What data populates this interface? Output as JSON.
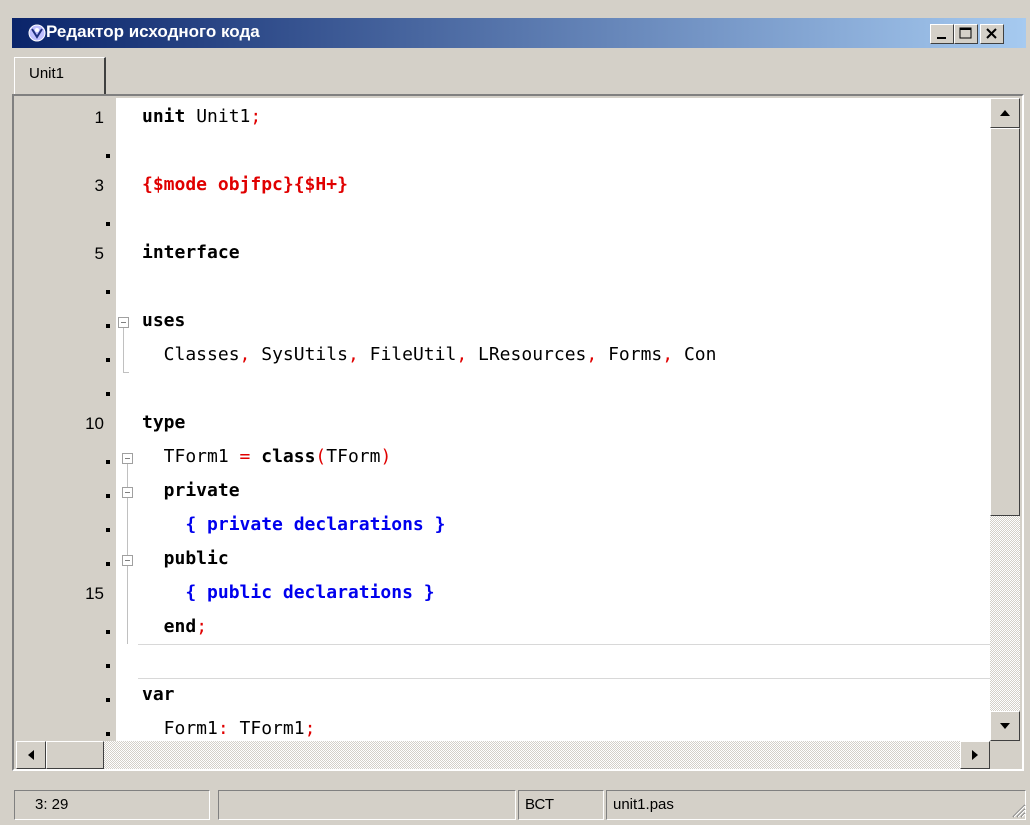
{
  "window": {
    "title": "Редактор исходного кода"
  },
  "tabs": [
    {
      "label": "Unit1"
    }
  ],
  "gutter": {
    "numbers": [
      "1",
      "3",
      "5",
      "10",
      "15"
    ]
  },
  "code": {
    "l1_kw": "unit",
    "l1_name": " Unit1",
    "l1_semi": ";",
    "l3_dir": "{$mode objfpc}{$H+}",
    "l5_kw": "interface",
    "l7_kw": "uses",
    "l8_a": "  Classes",
    "l8_c1": ",",
    "l8_b": " SysUtils",
    "l8_c2": ",",
    "l8_c": " FileUtil",
    "l8_c3": ",",
    "l8_d": " LResources",
    "l8_c4": ",",
    "l8_e": " Forms",
    "l8_c5": ",",
    "l8_f": " Con",
    "l10_kw": "type",
    "l11_a": "  TForm1 ",
    "l11_eq": "=",
    "l11_sp": " ",
    "l11_kw": "class",
    "l11_p1": "(",
    "l11_b": "TForm",
    "l11_p2": ")",
    "l12_kw": "  private",
    "l13_cmt": "    { private declarations }",
    "l14_kw": "  public",
    "l15_cmt": "    { public declarations }",
    "l16_kw": "  end",
    "l16_semi": ";",
    "l18_kw": "var",
    "l19_a": "  Form1",
    "l19_colon": ":",
    "l19_b": " TForm1",
    "l19_semi": ";"
  },
  "statusbar": {
    "position": "3: 29",
    "modified": "",
    "mode": "ВСТ",
    "file": "unit1.pas"
  },
  "colors": {
    "keyword": "#000000",
    "symbol": "#e00000",
    "directive": "#e00000",
    "comment": "#0000ee",
    "titlebar": "#0a246a"
  },
  "icons": [
    "app-icon",
    "minimize-icon",
    "maximize-icon",
    "close-icon",
    "arrow-up-icon",
    "arrow-down-icon",
    "arrow-left-icon",
    "arrow-right-icon",
    "fold-icon",
    "size-grip-icon"
  ]
}
